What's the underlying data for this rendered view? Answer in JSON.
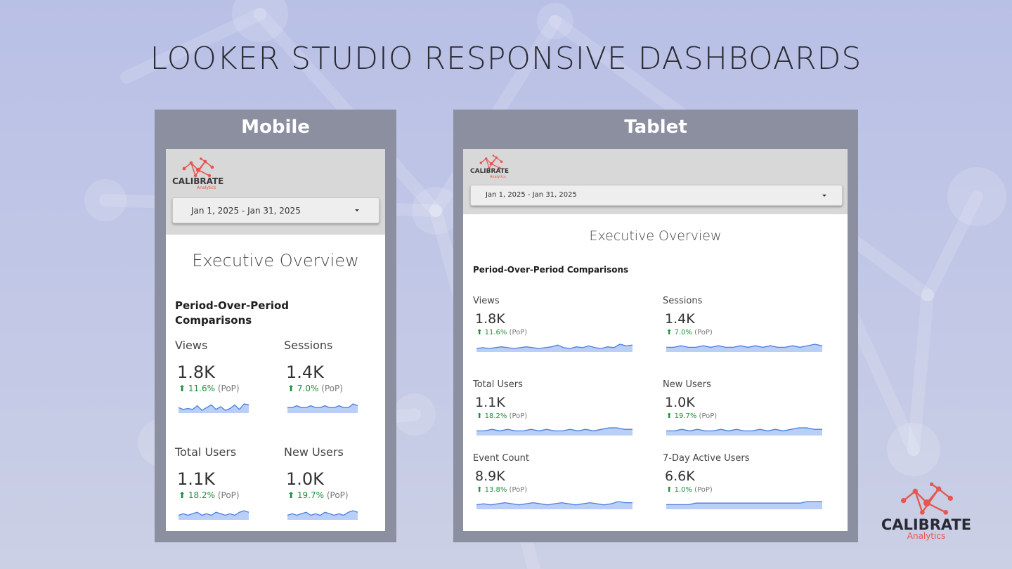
{
  "title": "LOOKER STUDIO RESPONSIVE DASHBOARDS",
  "colors": {
    "accent": "#e5574f",
    "positive": "#1e8e3e",
    "spark_line": "#4a7ee0",
    "spark_fill": "#a9c3f2",
    "frame": "#8b8fa0"
  },
  "brand": {
    "name": "CALIBRATE",
    "sub": "Analytics"
  },
  "mobile": {
    "label": "Mobile",
    "logo": {
      "name": "CALIBRATE",
      "sub": "Analytics"
    },
    "date_range": "Jan 1, 2025 - Jan 31, 2025",
    "report_title": "Executive Overview",
    "section_title": "Period-Over-Period Comparisons",
    "metrics": [
      {
        "label": "Views",
        "value": "1.8K",
        "delta": "11.6%",
        "suffix": "(PoP)",
        "spark": [
          6,
          4,
          5,
          4,
          8,
          3,
          6,
          9,
          4,
          7,
          3,
          5,
          9,
          4,
          10,
          9
        ]
      },
      {
        "label": "Sessions",
        "value": "1.4K",
        "delta": "7.0%",
        "suffix": "(PoP)",
        "spark": [
          3,
          3,
          4,
          3,
          3,
          4,
          3,
          3,
          4,
          3,
          3,
          4,
          3,
          3,
          5,
          4
        ]
      },
      {
        "label": "Total Users",
        "value": "1.1K",
        "delta": "18.2%",
        "suffix": "(PoP)",
        "spark": [
          3,
          4,
          3,
          4,
          5,
          3,
          4,
          3,
          5,
          4,
          3,
          4,
          3,
          5,
          6,
          5
        ]
      },
      {
        "label": "New Users",
        "value": "1.0K",
        "delta": "19.7%",
        "suffix": "(PoP)",
        "spark": [
          3,
          4,
          3,
          4,
          5,
          3,
          4,
          3,
          5,
          4,
          3,
          4,
          3,
          5,
          6,
          5
        ]
      }
    ]
  },
  "tablet": {
    "label": "Tablet",
    "logo": {
      "name": "CALIBRATE",
      "sub": "Analytics"
    },
    "date_range": "Jan 1, 2025 - Jan 31, 2025",
    "report_title": "Executive Overview",
    "section_title": "Period-Over-Period Comparisons",
    "metrics": [
      {
        "label": "Views",
        "value": "1.8K",
        "delta": "11.6%",
        "suffix": "(PoP)",
        "spark": [
          4,
          5,
          4,
          5,
          6,
          5,
          4,
          5,
          6,
          5,
          4,
          5,
          6,
          8,
          5,
          4,
          6,
          5,
          7,
          5,
          4,
          6,
          5,
          9,
          7,
          8
        ]
      },
      {
        "label": "Sessions",
        "value": "1.4K",
        "delta": "7.0%",
        "suffix": "(PoP)",
        "spark": [
          3,
          3,
          4,
          3,
          3,
          4,
          3,
          4,
          3,
          3,
          4,
          3,
          4,
          3,
          4,
          3,
          3,
          4,
          3,
          4,
          5,
          4
        ]
      },
      {
        "label": "Total Users",
        "value": "1.1K",
        "delta": "18.2%",
        "suffix": "(PoP)",
        "spark": [
          3,
          3,
          4,
          3,
          4,
          3,
          3,
          4,
          3,
          4,
          3,
          3,
          4,
          3,
          4,
          3,
          4,
          5,
          5,
          4,
          4
        ]
      },
      {
        "label": "New Users",
        "value": "1.0K",
        "delta": "19.7%",
        "suffix": "(PoP)",
        "spark": [
          3,
          3,
          4,
          3,
          4,
          3,
          3,
          4,
          3,
          4,
          3,
          3,
          4,
          3,
          4,
          3,
          4,
          5,
          5,
          4,
          4
        ]
      },
      {
        "label": "Event Count",
        "value": "8.9K",
        "delta": "13.8%",
        "suffix": "(PoP)",
        "spark": [
          4,
          5,
          4,
          5,
          6,
          5,
          4,
          5,
          6,
          5,
          4,
          5,
          6,
          5,
          4,
          5,
          6,
          5,
          4,
          5,
          7,
          6,
          6
        ]
      },
      {
        "label": "7-Day Active Users",
        "value": "6.6K",
        "delta": "1.0%",
        "suffix": "(PoP)",
        "spark": [
          3,
          3,
          3,
          3,
          4,
          4,
          4,
          4,
          4,
          4,
          4,
          4,
          4,
          4,
          4,
          4,
          4,
          4,
          4,
          5,
          5,
          5
        ]
      }
    ]
  }
}
